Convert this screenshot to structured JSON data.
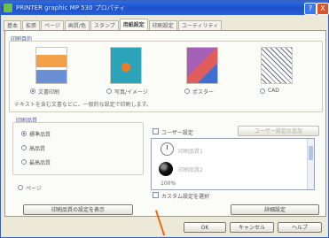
{
  "window": {
    "title": "PRINTER graphic MP 530 プロパティ",
    "help_glyph": "?",
    "close_glyph": "X"
  },
  "tabs": [
    {
      "label": "基本",
      "active": false
    },
    {
      "label": "拡張",
      "active": false
    },
    {
      "label": "ページ",
      "active": false
    },
    {
      "label": "画質/色",
      "active": false
    },
    {
      "label": "スタンプ",
      "active": false
    },
    {
      "label": "用紙設定",
      "active": true
    },
    {
      "label": "印刷設定",
      "active": false
    },
    {
      "label": "ユーティリティ",
      "active": false
    }
  ],
  "print_target": {
    "label": "印刷目的",
    "options": [
      {
        "label": "文書印刷",
        "selected": true,
        "icon": "document-thumbnail-icon"
      },
      {
        "label": "写真/イメージ",
        "selected": false,
        "icon": "photo-thumbnail-icon"
      },
      {
        "label": "ポスター",
        "selected": false,
        "icon": "poster-thumbnail-icon"
      },
      {
        "label": "CAD",
        "selected": false,
        "icon": "cad-thumbnail-icon"
      }
    ],
    "note": "テキストを含む文書などに、一般的な設定で印刷します。"
  },
  "quality": {
    "label": "印刷品質",
    "options": [
      {
        "label": "標準品質",
        "selected": true
      },
      {
        "label": "高品質",
        "selected": false
      },
      {
        "label": "最高品質",
        "selected": false
      }
    ]
  },
  "toggle": {
    "label": "ページ",
    "checked": false
  },
  "preview_button": "印刷品質の設定を表示",
  "user_settings": {
    "checkbox_label": "ユーザー設定",
    "top_right_button": "ユーザー設定の追加",
    "items": [
      {
        "icon": "clock-icon",
        "label": "印刷品質1"
      },
      {
        "icon": "ball-icon",
        "label": "印刷品質2"
      }
    ],
    "item_caption": "100%",
    "footer_label": "カスタム設定を選択"
  },
  "detail_button": "詳細設定",
  "dialog_buttons": {
    "ok": "OK",
    "cancel": "キャンセル",
    "help": "ヘルプ"
  },
  "colors": {
    "titlebar": "#1f50c8",
    "pointer": "#ee6a10"
  }
}
